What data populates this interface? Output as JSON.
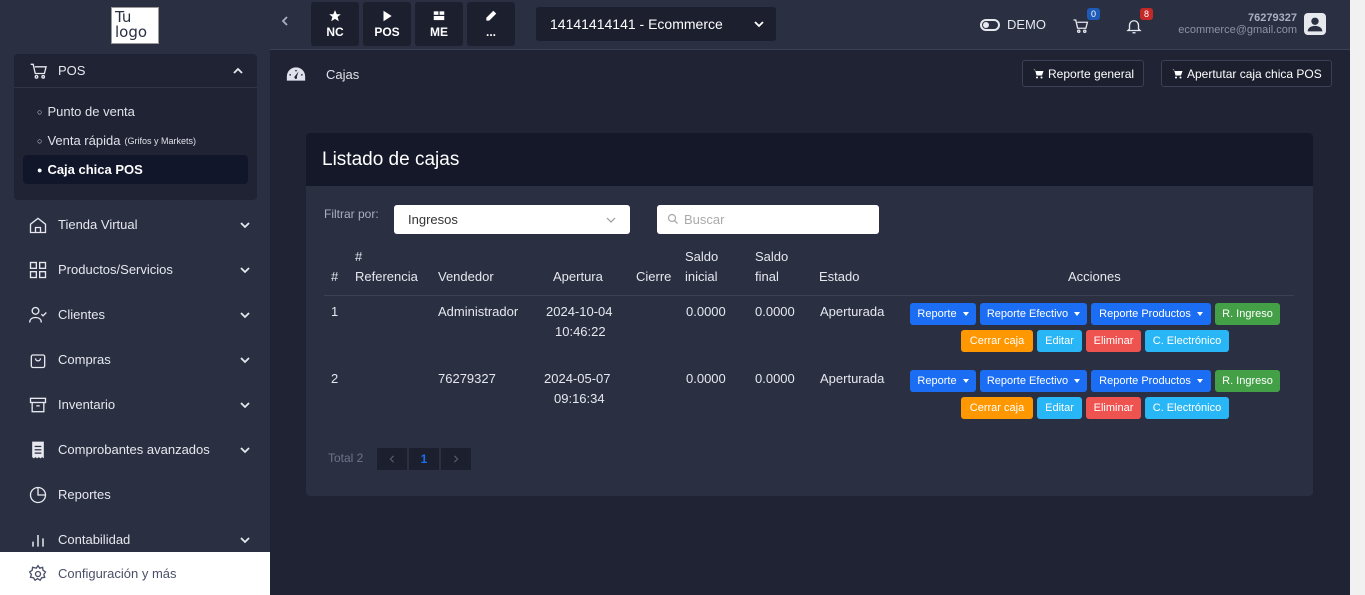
{
  "logo": {
    "line1": "Tu",
    "line2": "logo"
  },
  "sidebar": {
    "pos_label": "POS",
    "sub_items": [
      {
        "label": "Punto de venta",
        "note": ""
      },
      {
        "label": "Venta rápida",
        "note": "(Grifos y Markets)"
      },
      {
        "label": "Caja chica POS",
        "note": ""
      }
    ],
    "items": [
      {
        "label": "Tienda Virtual",
        "icon": "home-icon"
      },
      {
        "label": "Productos/Servicios",
        "icon": "grid-icon"
      },
      {
        "label": "Clientes",
        "icon": "user-check-icon"
      },
      {
        "label": "Compras",
        "icon": "bag-icon"
      },
      {
        "label": "Inventario",
        "icon": "archive-icon"
      },
      {
        "label": "Comprobantes avanzados",
        "icon": "receipt-icon"
      },
      {
        "label": "Reportes",
        "icon": "pie-chart-icon"
      },
      {
        "label": "Contabilidad",
        "icon": "bar-chart-icon"
      }
    ],
    "config_label": "Configuración y más"
  },
  "topbar": {
    "quick": [
      "NC",
      "POS",
      "ME",
      "..."
    ],
    "company": "14141414141 - Ecommerce",
    "demo": "DEMO",
    "cart_count": "0",
    "bell_count": "8",
    "user_id": "76279327",
    "user_email": "ecommerce@gmail.com"
  },
  "page": {
    "breadcrumb": "Cajas",
    "btn_report": "Reporte general",
    "btn_open": "Apertutar caja chica POS"
  },
  "card": {
    "title": "Listado de cajas",
    "filter_label": "Filtrar por:",
    "filter_value": "Ingresos",
    "search_placeholder": "Buscar"
  },
  "table": {
    "headers": {
      "num": "#",
      "ref1": "#",
      "ref2": "Referencia",
      "vendedor": "Vendedor",
      "apertura": "Apertura",
      "cierre": "Cierre",
      "saldo_i1": "Saldo",
      "saldo_i2": "inicial",
      "saldo_f1": "Saldo",
      "saldo_f2": "final",
      "estado": "Estado",
      "acciones": "Acciones"
    },
    "rows": [
      {
        "num": "1",
        "vendedor": "Administrador",
        "date": "2024-10-04",
        "time": "10:46:22",
        "saldo_i": "0.0000",
        "saldo_f": "0.0000",
        "estado": "Aperturada"
      },
      {
        "num": "2",
        "vendedor": "76279327",
        "date": "2024-05-07",
        "time": "09:16:34",
        "saldo_i": "0.0000",
        "saldo_f": "0.0000",
        "estado": "Aperturada"
      }
    ],
    "actions": {
      "reporte": "Reporte",
      "efectivo": "Reporte Efectivo",
      "productos": "Reporte Productos",
      "ingreso": "R. Ingreso",
      "cerrar": "Cerrar caja",
      "editar": "Editar",
      "eliminar": "Eliminar",
      "electronico": "C. Electrónico"
    }
  },
  "pagination": {
    "total": "Total 2",
    "current": "1"
  },
  "colors": {
    "accent": "#1b6ef3",
    "success": "#43a047",
    "warning": "#ff9800",
    "info": "#29b6f6",
    "danger": "#ef5350"
  }
}
